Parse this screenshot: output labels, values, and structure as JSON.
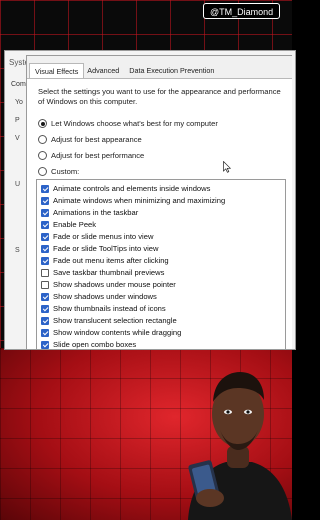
{
  "watermark": {
    "handle": "@TM_Diamond"
  },
  "parent_window": {
    "title_fragment": "Syste",
    "tab_fragment": "Com",
    "side_letters": [
      "Yo",
      "P",
      "V",
      "U",
      "S"
    ]
  },
  "dialog": {
    "tabs": [
      {
        "label": "Visual Effects",
        "active": true
      },
      {
        "label": "Advanced",
        "active": false
      },
      {
        "label": "Data Execution Prevention",
        "active": false
      }
    ],
    "intro": "Select the settings you want to use for the appearance and performance of Windows on this computer.",
    "options": [
      {
        "label": "Let Windows choose what's best for my computer",
        "selected": true
      },
      {
        "label": "Adjust for best appearance",
        "selected": false
      },
      {
        "label": "Adjust for best performance",
        "selected": false
      },
      {
        "label": "Custom:",
        "selected": false
      }
    ],
    "effects": [
      {
        "label": "Animate controls and elements inside windows",
        "checked": true
      },
      {
        "label": "Animate windows when minimizing and maximizing",
        "checked": true
      },
      {
        "label": "Animations in the taskbar",
        "checked": true
      },
      {
        "label": "Enable Peek",
        "checked": true
      },
      {
        "label": "Fade or slide menus into view",
        "checked": true
      },
      {
        "label": "Fade or slide ToolTips into view",
        "checked": true
      },
      {
        "label": "Fade out menu items after clicking",
        "checked": true
      },
      {
        "label": "Save taskbar thumbnail previews",
        "checked": false
      },
      {
        "label": "Show shadows under mouse pointer",
        "checked": false
      },
      {
        "label": "Show shadows under windows",
        "checked": true
      },
      {
        "label": "Show thumbnails instead of icons",
        "checked": true
      },
      {
        "label": "Show translucent selection rectangle",
        "checked": true
      },
      {
        "label": "Show window contents while dragging",
        "checked": true
      },
      {
        "label": "Slide open combo boxes",
        "checked": true
      }
    ]
  },
  "colors": {
    "grid_red": "#c8141e",
    "accent_blue": "#2c63c8",
    "bottom_red": "#e0262c"
  }
}
